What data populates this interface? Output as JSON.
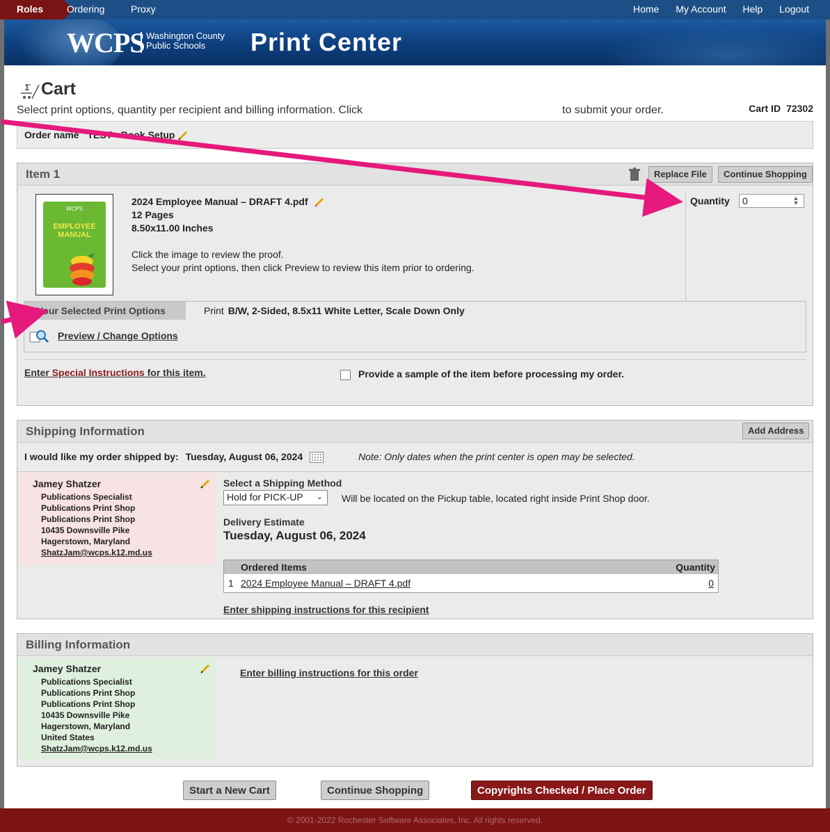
{
  "nav": {
    "roles": "Roles",
    "ordering": "Ordering",
    "proxy": "Proxy",
    "right": [
      "Home",
      "My Account",
      "Help",
      "Logout"
    ]
  },
  "banner": {
    "logo": "WCPS",
    "logo_sub_1": "Washington County",
    "logo_sub_2": "Public Schools",
    "title": "Print Center"
  },
  "cart": {
    "icon_number": "1",
    "title": "Cart",
    "desc_1": "Select print options, quantity per recipient and billing information. Click",
    "desc_2": "to submit your order.",
    "id_label": "Cart ID",
    "id_value": "72302"
  },
  "order_name": {
    "label": "Order name",
    "value": "TEST - Book Setup"
  },
  "item": {
    "title": "Item 1",
    "replace_btn": "Replace File",
    "continue_btn": "Continue Shopping",
    "thumb_top": "WCPS",
    "thumb_title": "EMPLOYEE MANUAL",
    "file_name": "2024 Employee Manual – DRAFT 4.pdf",
    "pages": "12 Pages",
    "size": "8.50x11.00 Inches",
    "hint_1": "Click the image to review the proof.",
    "hint_2": "Select your print options, then click Preview to review this item prior to ordering.",
    "quantity_label": "Quantity",
    "quantity_value": "0",
    "options_tab": "Your Selected Print Options",
    "print_label": "Print",
    "print_value": "B/W, 2-Sided, 8.5x11 White Letter, Scale Down Only",
    "preview_link": "Preview / Change Options",
    "special_prefix": "Enter ",
    "special_red": "Special Instructions",
    "special_suffix": " for this item.",
    "sample_text": "Provide a sample of the item before processing my order."
  },
  "shipping": {
    "title": "Shipping Information",
    "add_address_btn": "Add Address",
    "ship_by_label": "I would like my order shipped by:",
    "ship_by_date": "Tuesday, August 06, 2024",
    "note": "Note: Only dates when the print center is open may be selected.",
    "address": {
      "name": "Jamey Shatzer",
      "lines": [
        "Publications Specialist",
        "Publications Print Shop",
        "Publications Print Shop",
        "10435 Downsville Pike",
        "Hagerstown, Maryland"
      ],
      "email": "ShatzJam@wcps.k12.md.us"
    },
    "method_title": "Select a Shipping Method",
    "method_value": "Hold for PICK-UP",
    "method_note": "Will be located on the Pickup table, located right inside Print Shop door.",
    "delivery_title": "Delivery Estimate",
    "delivery_date": "Tuesday, August 06, 2024",
    "ordered_header": "Ordered Items",
    "quantity_header": "Quantity",
    "ordered_rows": [
      {
        "num": "1",
        "name": "2024 Employee Manual – DRAFT 4.pdf",
        "qty": "0"
      }
    ],
    "instructions_link": "Enter shipping instructions for this recipient"
  },
  "billing": {
    "title": "Billing Information",
    "address": {
      "name": "Jamey Shatzer",
      "lines": [
        "Publications Specialist",
        "Publications Print Shop",
        "Publications Print Shop",
        "10435 Downsville Pike",
        "Hagerstown, Maryland",
        "United States"
      ],
      "email": "ShatzJam@wcps.k12.md.us"
    },
    "instructions_link": "Enter billing instructions for this order"
  },
  "actions": {
    "new_cart": "Start a New Cart",
    "continue": "Continue Shopping",
    "place_order": "Copyrights Checked / Place Order"
  },
  "footer": "© 2001-2022 Rochester Software Associates, Inc. All rights reserved.",
  "colors": {
    "nav_blue": "#1d4f86",
    "maroon": "#7c1414",
    "annotation_pink": "#e6197c",
    "shipping_addr_bg": "#f7e3e3",
    "billing_addr_bg": "#dff0df"
  }
}
